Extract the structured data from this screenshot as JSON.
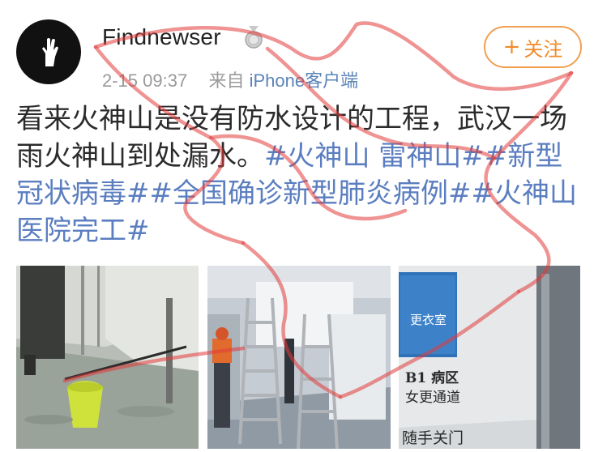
{
  "post": {
    "username": "Findnewser",
    "time": "2-15 09:37",
    "source_prefix": "来自",
    "source_name": "iPhone客户端",
    "follow_label": "关注",
    "follow_plus": "+",
    "text_main": "看来火神山是没有防水设计的工程，武汉一场雨火神山到处漏水。",
    "tags": [
      "#火神山 雷神山#",
      "#新型冠状病毒#",
      "#全国确诊新型肺炎病例#",
      "#火神山医院完工#"
    ]
  },
  "photos": {
    "photo3_sign": "更衣室",
    "photo3_label_1": "B1 病区",
    "photo3_label_2": "女更通道",
    "photo3_label_3": "随手关门"
  },
  "colors": {
    "tag": "#5b7ec0",
    "follow": "#f08b2a",
    "scribble": "#e23a3a"
  },
  "icons": [
    "hand-gesture-icon",
    "medal-icon",
    "plus-icon"
  ]
}
